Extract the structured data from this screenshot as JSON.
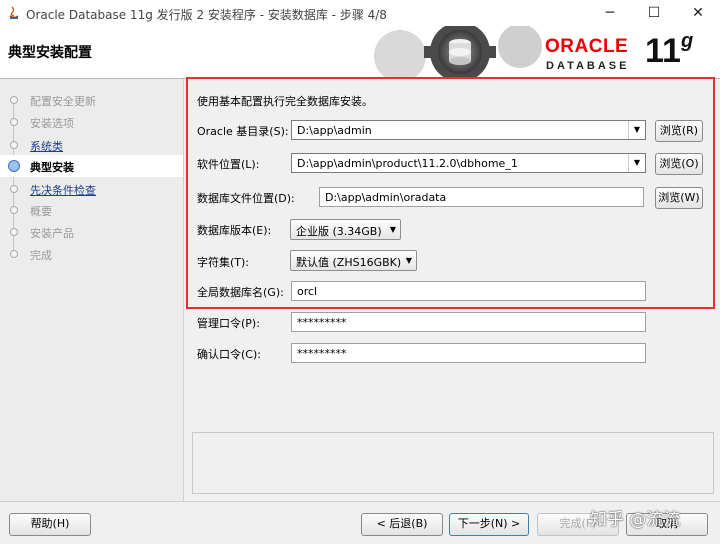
{
  "window": {
    "title": "Oracle Database 11g 发行版 2 安装程序 - 安装数据库 - 步骤 4/8",
    "minimize": "─",
    "maximize": "☐",
    "close": "✕"
  },
  "header": {
    "page_title": "典型安装配置",
    "logo_oracle": "ORACLE",
    "logo_database": "DATABASE",
    "logo_version": "11",
    "logo_version_suffix": "g"
  },
  "steps": [
    {
      "label": "配置安全更新",
      "state": "done"
    },
    {
      "label": "安装选项",
      "state": "done"
    },
    {
      "label": "系统类",
      "state": "link"
    },
    {
      "label": "典型安装",
      "state": "active"
    },
    {
      "label": "先决条件检查",
      "state": "link"
    },
    {
      "label": "概要",
      "state": "pending"
    },
    {
      "label": "安装产品",
      "state": "pending"
    },
    {
      "label": "完成",
      "state": "pending"
    }
  ],
  "form": {
    "intro": "使用基本配置执行完全数据库安装。",
    "oracle_base_label": "Oracle 基目录(S):",
    "oracle_base_value": "D:\\app\\admin",
    "oracle_base_browse": "浏览(R)",
    "software_location_label": "软件位置(L):",
    "software_location_value": "D:\\app\\admin\\product\\11.2.0\\dbhome_1",
    "software_location_browse": "浏览(O)",
    "datafile_location_label": "数据库文件位置(D):",
    "datafile_location_value": "D:\\app\\admin\\oradata",
    "datafile_location_browse": "浏览(W)",
    "edition_label": "数据库版本(E):",
    "edition_value": "企业版 (3.34GB)",
    "charset_label": "字符集(T):",
    "charset_value": "默认值 (ZHS16GBK)",
    "global_db_name_label": "全局数据库名(G):",
    "global_db_name_value": "orcl",
    "admin_password_label": "管理口令(P):",
    "admin_password_value": "*********",
    "confirm_password_label": "确认口令(C):",
    "confirm_password_value": "*********"
  },
  "footer": {
    "help": "帮助(H)",
    "back": "< 后退(B)",
    "next": "下一步(N) >",
    "finish": "完成(F)",
    "cancel": "取消"
  },
  "watermark": "知乎 @流流",
  "colors": {
    "highlight_border": "#e4312b",
    "oracle_red": "#ee0000",
    "link": "#1d3f8f"
  }
}
